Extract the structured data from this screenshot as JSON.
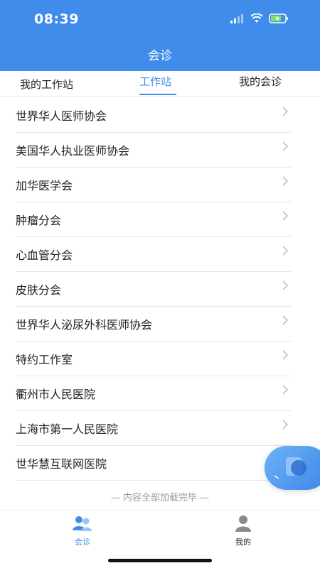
{
  "status_bar": {
    "time": "08:39"
  },
  "nav": {
    "title": "会诊"
  },
  "tabs": [
    {
      "label": "我的工作站"
    },
    {
      "label": "工作站",
      "active": true
    },
    {
      "label": "我的会诊"
    }
  ],
  "list": {
    "items": [
      {
        "label": "世界华人医师协会"
      },
      {
        "label": "美国华人执业医师协会"
      },
      {
        "label": "加华医学会"
      },
      {
        "label": "肿瘤分会"
      },
      {
        "label": "心血管分会"
      },
      {
        "label": "皮肤分会"
      },
      {
        "label": "世界华人泌尿外科医师协会"
      },
      {
        "label": "特约工作室"
      },
      {
        "label": "衢州市人民医院"
      },
      {
        "label": "上海市第一人民医院"
      },
      {
        "label": "世华慧互联网医院"
      }
    ],
    "end_text": "— 内容全部加载完毕 —"
  },
  "tabbar": {
    "items": [
      {
        "label": "会诊",
        "icon": "consultation-icon",
        "active": true
      },
      {
        "label": "我的",
        "icon": "user-icon"
      }
    ]
  },
  "colors": {
    "primary": "#3f8cea",
    "text": "#222222",
    "muted": "#999999"
  }
}
